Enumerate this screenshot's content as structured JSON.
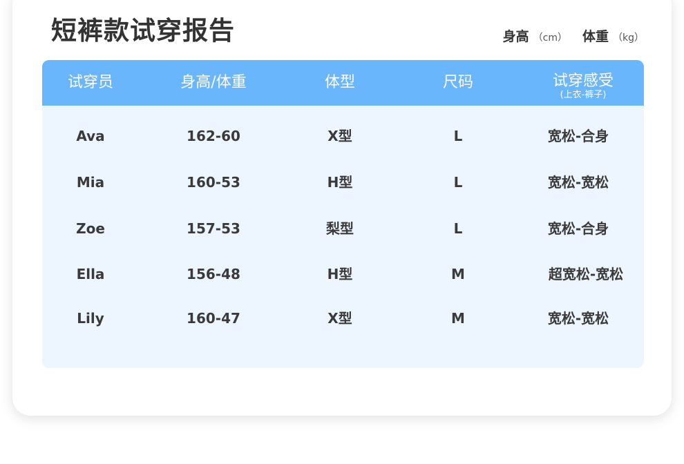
{
  "title": "短裤款试穿报告",
  "units": [
    {
      "label": "身高",
      "unit": "（cm）"
    },
    {
      "label": "体重",
      "unit": "（kg）"
    }
  ],
  "table": {
    "headers": [
      "试穿员",
      "身高/体重",
      "体型",
      "尺码",
      "试穿感受"
    ],
    "feel_sub": "(上衣-裤子)",
    "rows": [
      [
        "Ava",
        "162-60",
        "X型",
        "L",
        "宽松-合身"
      ],
      [
        "Mia",
        "160-53",
        "H型",
        "L",
        "宽松-宽松"
      ],
      [
        "Zoe",
        "157-53",
        "梨型",
        "L",
        "宽松-合身"
      ],
      [
        "Ella",
        "156-48",
        "H型",
        "M",
        "超宽松-宽松"
      ],
      [
        "Lily",
        "160-47",
        "X型",
        "M",
        "宽松-宽松"
      ]
    ]
  }
}
